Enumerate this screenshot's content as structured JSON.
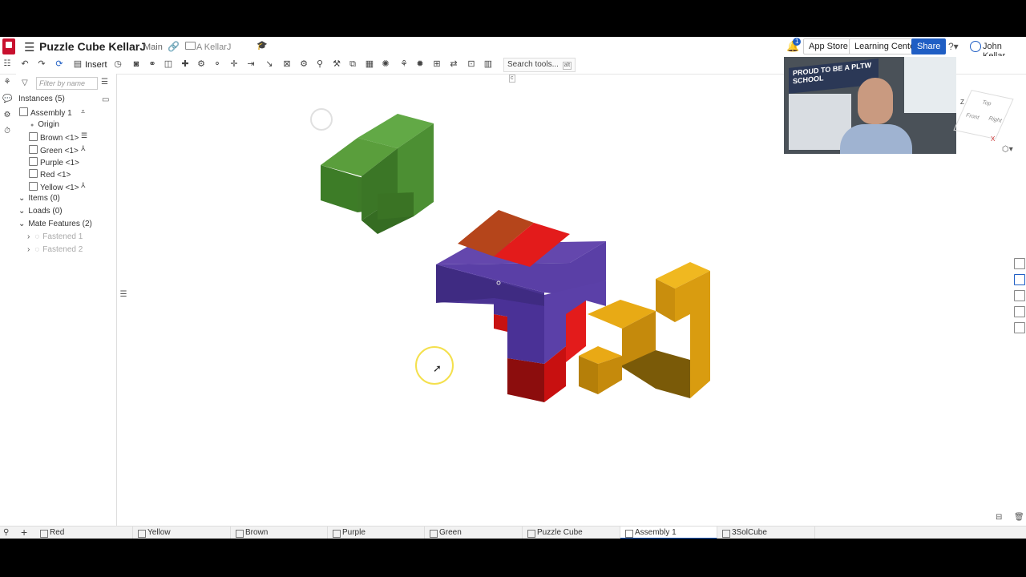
{
  "app": {
    "document_title": "Puzzle Cube KellarJ",
    "branch": "Main",
    "folder": "A KellarJ",
    "notifications": "1",
    "buttons": {
      "app_store": "App Store",
      "learning_center": "Learning Center",
      "share": "Share"
    },
    "user": "John Kellar"
  },
  "toolbar": {
    "insert_label": "Insert",
    "search_tools": "Search tools...",
    "search_shortcut": [
      "alt",
      "c"
    ]
  },
  "feature_panel": {
    "filter_placeholder": "Filter by name",
    "instances_header": "Instances (5)",
    "assembly": "Assembly 1",
    "origin": "Origin",
    "parts": [
      {
        "label": "Brown <1>"
      },
      {
        "label": "Green <1>"
      },
      {
        "label": "Purple <1>"
      },
      {
        "label": "Red <1>"
      },
      {
        "label": "Yellow <1>"
      }
    ],
    "items": "Items (0)",
    "loads": "Loads (0)",
    "mate_features": "Mate Features (2)",
    "mates": [
      "Fastened 1",
      "Fastened 2"
    ]
  },
  "webcam": {
    "banner": "PROUD TO BE A PLTW SCHOOL"
  },
  "viewcube": {
    "front": "Front",
    "top": "Top",
    "right": "Right",
    "axis_z": "Z",
    "axis_x": "X"
  },
  "colors": {
    "green": "#4e9a35",
    "purple": "#5a3fa6",
    "red": "#e31b1b",
    "brown": "#b5451b",
    "yellow": "#e2ad1a",
    "accent": "#1f5ec4"
  },
  "tabs": [
    {
      "label": "Red"
    },
    {
      "label": "Yellow"
    },
    {
      "label": "Brown"
    },
    {
      "label": "Purple"
    },
    {
      "label": "Green"
    },
    {
      "label": "Puzzle Cube"
    },
    {
      "label": "Assembly 1",
      "active": true
    },
    {
      "label": "3SolCube"
    }
  ]
}
